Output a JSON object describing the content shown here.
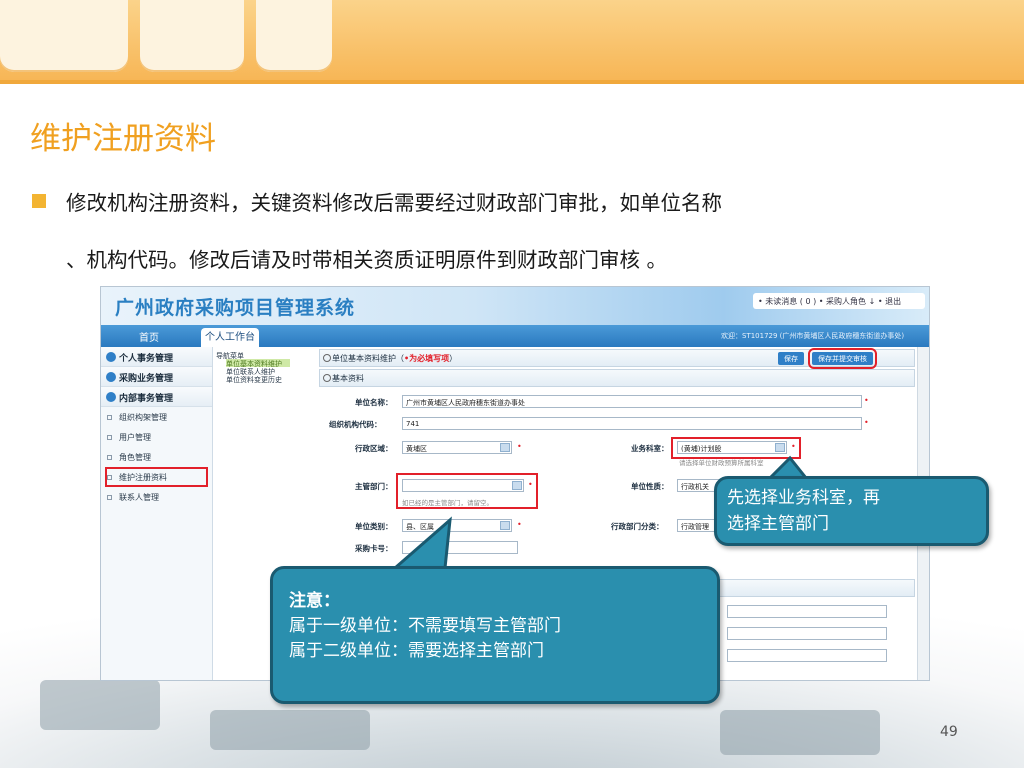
{
  "slide": {
    "title": "维护注册资料",
    "bullet_line1": "修改机构注册资料，关键资料修改后需要经过财政部门审批，如单位名称",
    "bullet_line2": "、机构代码。修改后请及时带相关资质证明原件到财政部门审核  。",
    "page_number": "49",
    "accent_color": "#f0a020"
  },
  "app": {
    "logo": "广州政府采购项目管理系统",
    "top_links": "• 未读消息 ( 0 )    • 采购人角色 ↓    • 退出",
    "nav_home": "首页",
    "nav_tab": "个人工作台",
    "welcome": "欢迎：ST101729 (广州市黄埔区人民政府穗东街道办事处)"
  },
  "sidebar": {
    "sections": [
      "个人事务管理",
      "采购业务管理",
      "内部事务管理"
    ],
    "items": [
      "组织构架管理",
      "用户管理",
      "角色管理",
      "维护注册资料",
      "联系人管理"
    ]
  },
  "tree": {
    "title": "导航菜单",
    "items": [
      "单位基本资料维护",
      "单位联系人维护",
      "单位资料变更历史"
    ]
  },
  "form": {
    "section_title": "单位基本资料维护（",
    "section_req": "•为必填写项",
    "section_close": "）",
    "save_button": "保存",
    "submit_button": "保存并提交审核",
    "basic_bar": "基本资料",
    "unit_name_label": "单位名称：",
    "unit_name_value": "广州市黄埔区人民政府穗东街道办事处",
    "org_code_label": "组织机构代码：",
    "org_code_value": "741",
    "district_label": "行政区域：",
    "district_value": "黄埔区",
    "business_dept_label": "业务科室：",
    "business_dept_value": "(黄埔)计划股",
    "business_dept_hint": "请选择单位财政预算所属科室",
    "supervisor_label": "主管部门：",
    "supervisor_value": "",
    "supervisor_hint": "如已经的是主管部门，请留空。",
    "unit_nature_label": "单位性质：",
    "unit_nature_value": "行政机关",
    "unit_type_label": "单位类别：",
    "unit_type_value": "县、区属",
    "admin_class_label": "行政部门分类：",
    "admin_class_value": "行政管理",
    "card_label": "采购卡号："
  },
  "callouts": {
    "right_line1": "先选择业务科室，再",
    "right_line2": "选择主管部门",
    "note_head": "注意：",
    "note_line1": "属于一级单位：不需要填写主管部门",
    "note_line2": "属于二级单位：需要选择主管部门"
  }
}
